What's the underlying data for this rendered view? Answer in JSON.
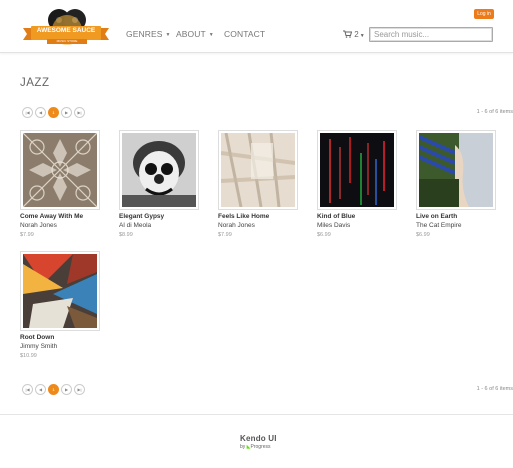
{
  "brand": {
    "logo_text": "AWESOME SAUCE",
    "logo_subtext": "MUSIC STORE"
  },
  "nav": {
    "items": [
      {
        "label": "GENRES",
        "has_dropdown": true
      },
      {
        "label": "ABOUT",
        "has_dropdown": true
      },
      {
        "label": "CONTACT",
        "has_dropdown": false
      }
    ]
  },
  "header": {
    "login_label": "Log in",
    "cart_count": "2",
    "search_placeholder": "Search music..."
  },
  "page": {
    "title": "JAZZ"
  },
  "pager": {
    "pages": [
      "1"
    ],
    "current": "1",
    "info": "1 - 6 of 6 items"
  },
  "products": [
    {
      "title": "Come Away With Me",
      "artist": "Norah Jones",
      "price": "$7.99",
      "art": "pattern-taupe-icon"
    },
    {
      "title": "Elegant Gypsy",
      "artist": "Al di Meola",
      "price": "$8.99",
      "art": "clown-bw-icon"
    },
    {
      "title": "Feels Like Home",
      "artist": "Norah Jones",
      "price": "$7.99",
      "art": "beige-abstract-icon"
    },
    {
      "title": "Kind of Blue",
      "artist": "Miles Davis",
      "price": "$6.99",
      "art": "neon-lines-icon"
    },
    {
      "title": "Live on Earth",
      "artist": "The Cat Empire",
      "price": "$6.99",
      "art": "striped-figure-icon"
    },
    {
      "title": "Root Down",
      "artist": "Jimmy Smith",
      "price": "$10.99",
      "art": "colored-planes-icon"
    }
  ],
  "footer": {
    "kendo_label": "Kendo UI",
    "by_label": "by",
    "progress_label": "Progress"
  },
  "colors": {
    "accent": "#ee8a1a",
    "text": "#333333",
    "muted": "#999999"
  }
}
